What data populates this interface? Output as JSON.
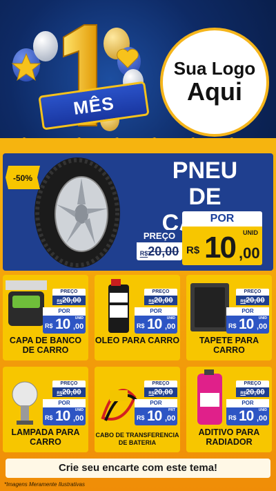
{
  "header": {
    "number": "1",
    "banner": "MÊS",
    "logo_line1": "Sua Logo",
    "logo_line2": "Aqui"
  },
  "hero": {
    "discount": "-50%",
    "title": "PNEU DE CARRO",
    "preco_label": "PREÇO",
    "old_currency": "R$",
    "old_price": "20,00",
    "por_label": "POR",
    "currency": "R$",
    "price_int": "10",
    "price_dec": ",00",
    "unit": "UNID"
  },
  "products": [
    {
      "name": "CAPA DE BANCO DE CARRO",
      "preco_label": "PREÇO",
      "old_currency": "R$",
      "old_price": "20,00",
      "por_label": "POR",
      "currency": "R$",
      "price_int": "10",
      "price_dec": ",00",
      "unit": "UNID"
    },
    {
      "name": "OLEO PARA CARRO",
      "preco_label": "PREÇO",
      "old_currency": "R$",
      "old_price": "20,00",
      "por_label": "POR",
      "currency": "R$",
      "price_int": "10",
      "price_dec": ",00",
      "unit": "UNID"
    },
    {
      "name": "TAPETE PARA CARRO",
      "preco_label": "PREÇO",
      "old_currency": "R$",
      "old_price": "20,00",
      "por_label": "POR",
      "currency": "R$",
      "price_int": "10",
      "price_dec": ",00",
      "unit": "UNID"
    },
    {
      "name": "LAMPADA PARA CARRO",
      "preco_label": "PREÇO",
      "old_currency": "R$",
      "old_price": "20,00",
      "por_label": "POR",
      "currency": "R$",
      "price_int": "10",
      "price_dec": ",00",
      "unit": "UNID"
    },
    {
      "name": "CABO DE TRANSFERENCIA DE BATERIA",
      "preco_label": "PREÇO",
      "old_currency": "R$",
      "old_price": "20,00",
      "por_label": "POR",
      "currency": "R$",
      "price_int": "10",
      "price_dec": ",00",
      "unit": "PRT"
    },
    {
      "name": "ADITIVO PARA RADIADOR",
      "preco_label": "PREÇO",
      "old_currency": "R$",
      "old_price": "20,00",
      "por_label": "POR",
      "currency": "R$",
      "price_int": "10",
      "price_dec": ",00",
      "unit": "UNID"
    }
  ],
  "cta": "Crie seu encarte com este tema!",
  "disclaimer": "*Imagens Meramente Ilustrativas",
  "colors": {
    "navy": "#1f3f8f",
    "yellow": "#f7c600",
    "orange": "#f08d07",
    "accent_blue": "#2d55c4"
  }
}
